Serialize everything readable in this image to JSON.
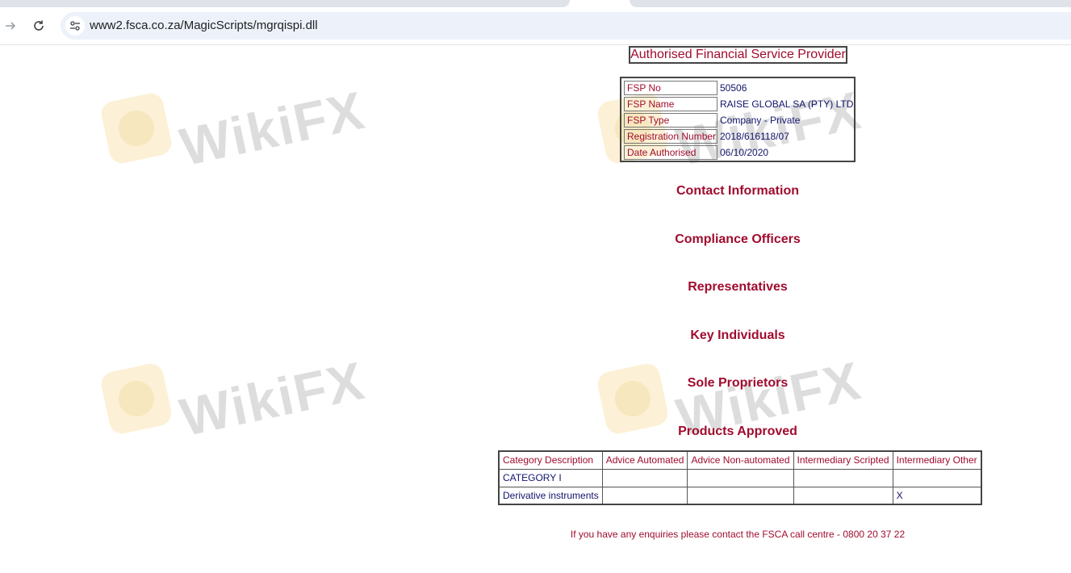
{
  "browser": {
    "url": "www2.fsca.co.za/MagicScripts/mgrqispi.dll"
  },
  "page": {
    "title": "Authorised Financial Service Provider",
    "fsp_details": [
      {
        "label": "FSP No",
        "value": "50506"
      },
      {
        "label": "FSP Name",
        "value": "RAISE GLOBAL SA (PTY) LTD"
      },
      {
        "label": "FSP Type",
        "value": "Company - Private"
      },
      {
        "label": "Registration Number",
        "value": "2018/616118/07"
      },
      {
        "label": "Date Authorised",
        "value": "06/10/2020"
      }
    ],
    "sections": {
      "contact": "Contact Information",
      "compliance": "Compliance Officers",
      "representatives": "Representatives",
      "key_individuals": "Key Individuals",
      "sole_proprietors": "Sole Proprietors",
      "products": "Products Approved"
    },
    "products_table": {
      "headers": [
        "Category Description",
        "Advice Automated",
        "Advice Non-automated",
        "Intermediary Scripted",
        "Intermediary Other"
      ],
      "rows": [
        [
          "CATEGORY I",
          "",
          "",
          "",
          ""
        ],
        [
          "Derivative instruments",
          "",
          "",
          "",
          "X"
        ]
      ]
    },
    "footer": "If you have any enquiries please contact the FSCA call centre - 0800 20 37 22"
  },
  "watermark": {
    "text": "WikiFX"
  },
  "icons": {
    "forward": "arrow-right-icon",
    "reload": "reload-icon",
    "site_info": "tune-icon"
  }
}
